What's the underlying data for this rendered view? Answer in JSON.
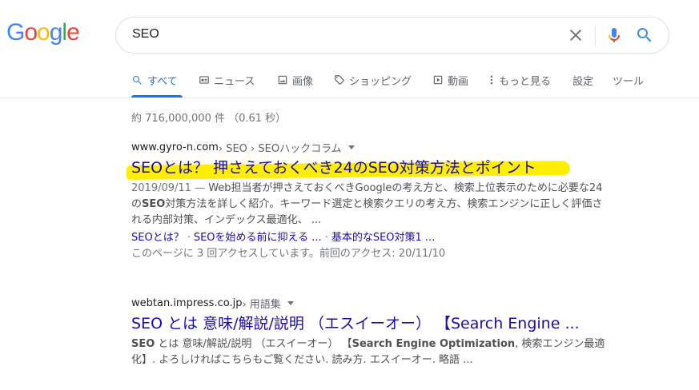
{
  "logo": [
    "G",
    "o",
    "o",
    "g",
    "l",
    "e"
  ],
  "logo_colors": [
    "#4285f4",
    "#ea4335",
    "#fbbc05",
    "#4285f4",
    "#34a853",
    "#ea4335"
  ],
  "search": {
    "query": "SEO"
  },
  "tabs": [
    {
      "label": "すべて",
      "icon": "search-icon"
    },
    {
      "label": "ニュース",
      "icon": "news-icon"
    },
    {
      "label": "画像",
      "icon": "image-icon"
    },
    {
      "label": "ショッピング",
      "icon": "tag-icon"
    },
    {
      "label": "動画",
      "icon": "video-icon"
    },
    {
      "label": "もっと見る",
      "icon": "more-icon"
    },
    {
      "label": "設定"
    },
    {
      "label": "ツール"
    }
  ],
  "stats": "約 716,000,000 件 （0.61 秒）",
  "results": [
    {
      "site": "www.gyro-n.com",
      "path": " › SEO › SEOハックコラム",
      "title": "SEOとは？ 押さえておくべき24のSEO対策方法とポイント",
      "date": "2019/09/11 — ",
      "snippet_a": "Web担当者が押さえておくべきGoogleの考え方と、検索上位表示のために必要な24の",
      "snippet_b": "SEO",
      "snippet_c": "対策方法を詳しく紹介。キーワード選定と検索クエリの考え方、検索エンジンに正しく評価される内部対策、インデックス最適化、 ...",
      "sitelinks": [
        "SEOとは？",
        "SEOを始める前に抑える ...",
        "基本的なSEO対策1 ..."
      ],
      "sitelink_sep": "·",
      "visited": "このページに 3 回アクセスしています。前回のアクセス: 20/11/10"
    },
    {
      "site": "webtan.impress.co.jp",
      "path": " › 用語集",
      "title": "SEO とは 意味/解説/説明 （エスイーオー） 【Search Engine ...",
      "snippet_a": "SEO",
      "snippet_b": " とは 意味/解説/説明 （エスイーオー） 【",
      "snippet_c": "Search Engine Optimization",
      "snippet_d": ", 検索エンジン最適化】. よろしければこちらもご覧ください. 読み方. エスイーオー. 略語 ..."
    }
  ],
  "colors": {
    "link": "#1a0dab",
    "accent": "#1a73e8",
    "highlight": "#ffee00"
  }
}
